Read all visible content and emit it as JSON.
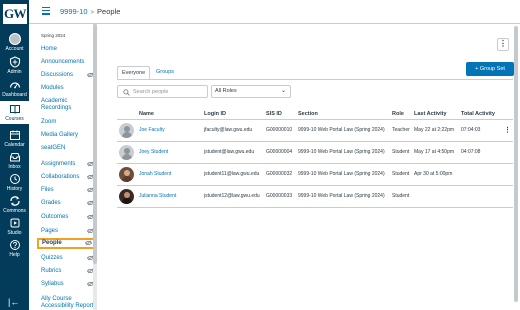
{
  "global_nav": {
    "logo_text": "GW",
    "items": [
      {
        "label": "Account",
        "icon": "avatar-icon"
      },
      {
        "label": "Admin",
        "icon": "admin-shield-icon"
      },
      {
        "label": "Dashboard",
        "icon": "dashboard-icon"
      },
      {
        "label": "Courses",
        "icon": "courses-book-icon"
      },
      {
        "label": "Calendar",
        "icon": "calendar-icon"
      },
      {
        "label": "Inbox",
        "icon": "inbox-icon"
      },
      {
        "label": "History",
        "icon": "history-clock-icon"
      },
      {
        "label": "Commons",
        "icon": "commons-icon"
      },
      {
        "label": "Studio",
        "icon": "studio-icon"
      },
      {
        "label": "Help",
        "icon": "help-icon"
      }
    ],
    "active": "Courses",
    "collapse_icon": "collapse-arrow-icon"
  },
  "breadcrumb": {
    "course": "9999-10",
    "separator": ">",
    "current": "People"
  },
  "course_nav": {
    "term": "Spring 2024",
    "items": [
      {
        "label": "Home",
        "hidden": false
      },
      {
        "label": "Announcements",
        "hidden": false
      },
      {
        "label": "Discussions",
        "hidden": true
      },
      {
        "label": "Modules",
        "hidden": false
      },
      {
        "label": "Academic Recordings",
        "hidden": false
      },
      {
        "label": "Zoom",
        "hidden": false
      },
      {
        "label": "Media Gallery",
        "hidden": false
      },
      {
        "label": "seatGEN",
        "hidden": false
      },
      {
        "label": "Assignments",
        "hidden": true
      },
      {
        "label": "Collaborations",
        "hidden": true
      },
      {
        "label": "Files",
        "hidden": true
      },
      {
        "label": "Grades",
        "hidden": true
      },
      {
        "label": "Outcomes",
        "hidden": true
      },
      {
        "label": "Pages",
        "hidden": true
      },
      {
        "label": "People",
        "hidden": true
      },
      {
        "label": "Quizzes",
        "hidden": true
      },
      {
        "label": "Rubrics",
        "hidden": true
      },
      {
        "label": "Syllabus",
        "hidden": true
      },
      {
        "label": "Ally Course Accessibility Report",
        "hidden": false
      }
    ],
    "active": "People"
  },
  "people": {
    "tabs": [
      "Everyone",
      "Groups"
    ],
    "active_tab": "Everyone",
    "group_set_button": "+ Group Set",
    "search_placeholder": "Search people",
    "role_filter": "All Roles",
    "columns": [
      "Name",
      "Login ID",
      "SIS ID",
      "Section",
      "Role",
      "Last Activity",
      "Total Activity"
    ],
    "rows": [
      {
        "avatar": "default",
        "name": "Joe Faculty",
        "login": "jfaculty@law.gwu.edu",
        "sis": "G00000010",
        "section": "9999-10 Web Portal Law (Spring 2024)",
        "role": "Teacher",
        "last_activity": "May 22 at 2:22pm",
        "total_activity": "07:04:03",
        "menu": "⋮"
      },
      {
        "avatar": "default",
        "name": "Joey Student",
        "login": "jstudent@law.gwu.edu",
        "sis": "G00000004",
        "section": "9999-10 Web Portal Law (Spring 2024)",
        "role": "Student",
        "last_activity": "May 17 at 4:50pm",
        "total_activity": "04:07:08",
        "menu": ""
      },
      {
        "avatar": "photo1",
        "name": "Jonah Student",
        "login": "jstudent11@law.gwu.edu",
        "sis": "G00000032",
        "section": "9999-10 Web Portal Law (Spring 2024)",
        "role": "Student",
        "last_activity": "Apr 30 at 5:00pm",
        "total_activity": "",
        "menu": ""
      },
      {
        "avatar": "photo2",
        "name": "Julianna Student",
        "login": "jstudent12@law.gwu.edu",
        "sis": "G00000033",
        "section": "9999-10 Web Portal Law (Spring 2024)",
        "role": "Student",
        "last_activity": "",
        "total_activity": "",
        "menu": ""
      }
    ]
  },
  "colors": {
    "nav_bg": "#033c5a",
    "link": "#0374b5",
    "active_outline": "#f0a11e",
    "button": "#0374b5"
  }
}
